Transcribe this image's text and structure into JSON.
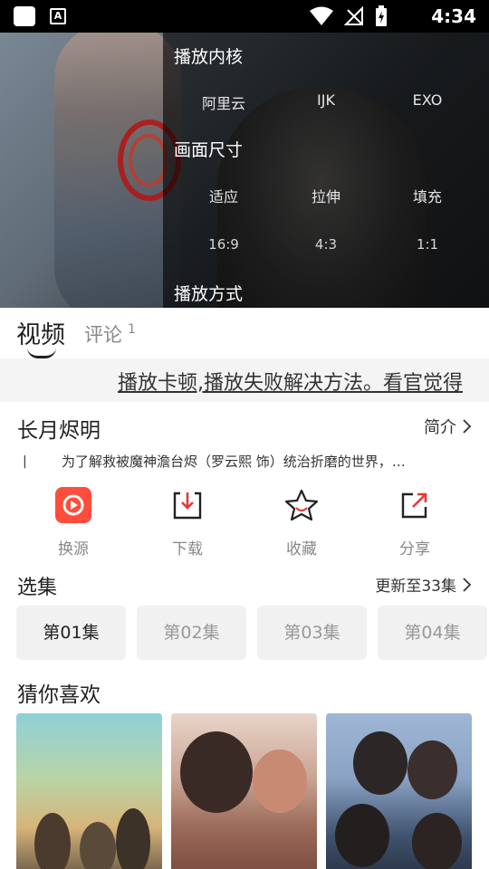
{
  "status_bar": {
    "time": "4:34",
    "badge": "A"
  },
  "player_menu": {
    "kernel": {
      "title": "播放内核",
      "options": [
        "阿里云",
        "IJK",
        "EXO"
      ]
    },
    "size": {
      "title": "画面尺寸",
      "options": [
        "适应",
        "拉伸",
        "填充"
      ],
      "ratios": [
        "16:9",
        "4:3",
        "1:1"
      ]
    },
    "mode": {
      "title": "播放方式"
    }
  },
  "tabs": {
    "video": "视频",
    "comment": "评论",
    "comment_count": "1"
  },
  "notice": "播放卡顿,播放失败解决方法。看官觉得",
  "show": {
    "title": "长月烬明",
    "intro_link": "简介",
    "desc_marker": "|",
    "description": "为了解救被魔神澹台烬（罗云熙 饰）统治折磨的世界，…"
  },
  "actions": [
    {
      "label": "换源",
      "icon": "switch-source-icon"
    },
    {
      "label": "下载",
      "icon": "download-icon"
    },
    {
      "label": "收藏",
      "icon": "star-icon"
    },
    {
      "label": "分享",
      "icon": "share-icon"
    }
  ],
  "episodes": {
    "title": "选集",
    "update": "更新至33集",
    "items": [
      "第01集",
      "第02集",
      "第03集",
      "第04集"
    ],
    "active_index": 0
  },
  "recommend": {
    "title": "猜你喜欢"
  },
  "colors": {
    "accent": "#ff4d3d",
    "share_accent": "#e53935"
  }
}
